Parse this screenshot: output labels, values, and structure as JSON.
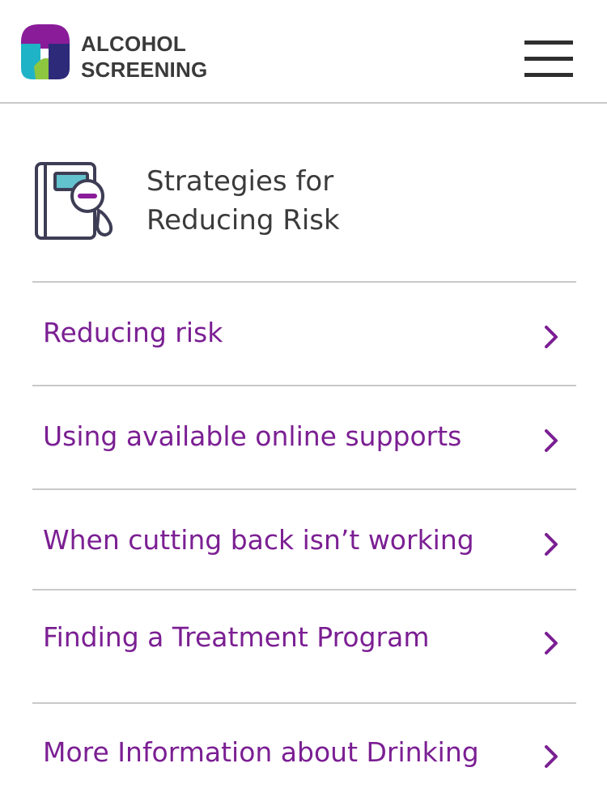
{
  "header": {
    "brand_line1": "ALCOHOL",
    "brand_line2": "SCREENING",
    "logo_icon": "alcohol-screening-logo",
    "menu_icon": "hamburger-menu-icon"
  },
  "section": {
    "title_line1": "Strategies for",
    "title_line2": "Reducing Risk",
    "icon": "notebook-magnifier-icon"
  },
  "nav_items": [
    {
      "label": "Reducing risk",
      "icon": "chevron-right-icon"
    },
    {
      "label": "Using available online supports",
      "icon": "chevron-right-icon"
    },
    {
      "label": "When cutting back isn’t working",
      "icon": "chevron-right-icon"
    },
    {
      "label": "Finding a Treatment Program",
      "icon": "chevron-right-icon"
    },
    {
      "label": "More Information about Drinking",
      "icon": "chevron-right-icon"
    }
  ],
  "colors": {
    "accent_purple": "#7b1f93",
    "logo_teal": "#1fb3c7",
    "logo_green": "#8dc63f",
    "logo_navy": "#2d2a7a",
    "text_dark": "#3b3b3b",
    "divider": "#c9c9c9"
  }
}
